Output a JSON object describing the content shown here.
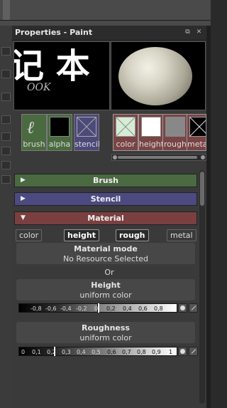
{
  "panel": {
    "title": "Properties - Paint"
  },
  "preview": {
    "brush_glyph": "记 本",
    "brush_sub": "OOK"
  },
  "thumbs": {
    "brush": "brush",
    "alpha": "alpha",
    "stencil": "stencil",
    "color": "color",
    "height": "height",
    "rough": "rough",
    "metal": "meta"
  },
  "sections": {
    "brush": "Brush",
    "stencil": "Stencil",
    "material": "Material"
  },
  "channels": [
    "color",
    "height",
    "rough",
    "metal"
  ],
  "material_mode": {
    "label": "Material mode",
    "value": "No Resource Selected"
  },
  "or_text": "Or",
  "height": {
    "label": "Height",
    "value": "uniform color",
    "ticks": [
      "-0,8",
      "-0,6",
      "-0,4",
      "-0,2",
      "0",
      "0,2",
      "0,4",
      "0,6",
      "0,8"
    ]
  },
  "roughness": {
    "label": "Roughness",
    "value": "uniform color",
    "ticks": [
      "0",
      "0,1",
      "0,2",
      "0,3",
      "0,4",
      "0,5",
      "0,6",
      "0,7",
      "0,8",
      "0,9",
      "1"
    ]
  },
  "colors": {
    "brush": "#4b6a42",
    "stencil": "#4c4a80",
    "material": "#7a4040"
  }
}
